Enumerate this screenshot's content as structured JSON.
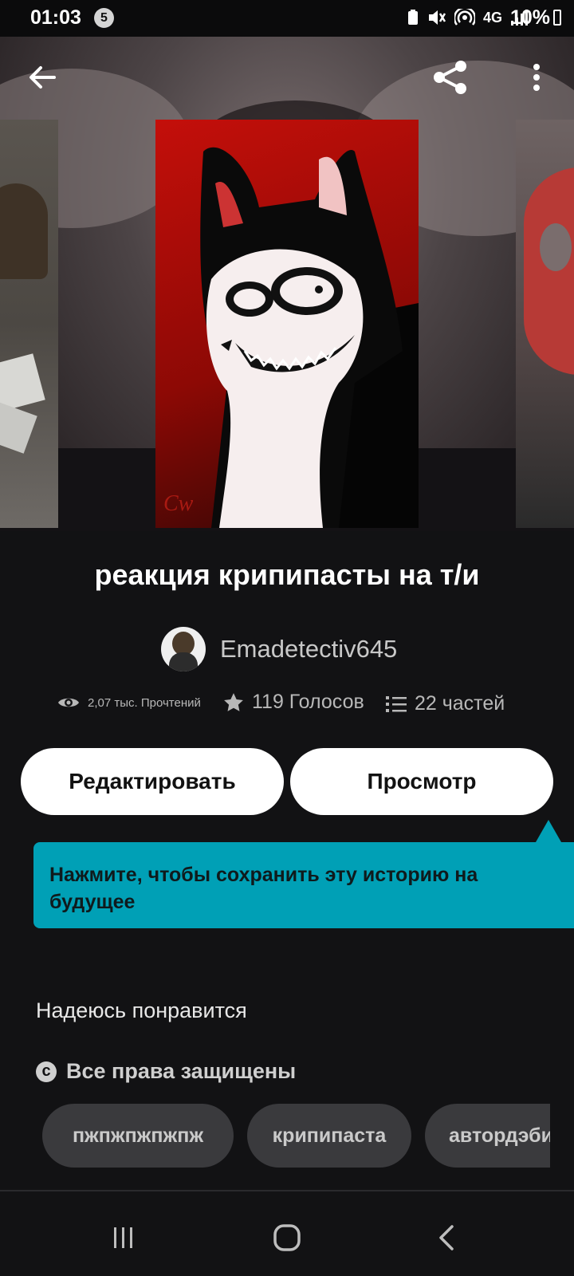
{
  "status_bar": {
    "time": "01:03",
    "notification_count": "5",
    "network": "4G",
    "battery": "10%"
  },
  "toolbar": {
    "back_icon": "arrow-left-icon",
    "share_icon": "share-icon",
    "more_icon": "more-vertical-icon"
  },
  "story": {
    "title": "реакция крипипасты на т/и",
    "author": "Emadetectiv645",
    "reads": "2,07 тыс. Прочтений",
    "votes": "119 Голосов",
    "parts": "22 частей"
  },
  "actions": {
    "edit_label": "Редактировать",
    "view_label": "Просмотр"
  },
  "tooltip": {
    "text": "Нажмите, чтобы сохранить эту историю на будущее"
  },
  "details": {
    "description": "Надеюсь понравится",
    "copyright": "Все права защищены"
  },
  "tags": [
    "пжпжпжпжпж",
    "крипипаста",
    "автордэбил"
  ],
  "colors": {
    "accent": "#00a0b6",
    "background": "#121214",
    "button": "#ffffff"
  }
}
